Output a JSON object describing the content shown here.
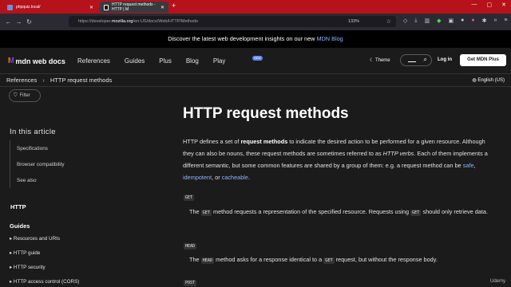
{
  "browser": {
    "tabs": [
      {
        "title": "phpquiz.local/",
        "active": false
      },
      {
        "title": "HTTP request methods - HTTP | M",
        "active": true
      }
    ],
    "url_prefix": "https://developer.",
    "url_domain": "mozilla.org",
    "url_path": "/en-US/docs/Web/HTTP/Methods",
    "zoom": "133%"
  },
  "banner": {
    "text": "Discover the latest web development insights on our new ",
    "link": "MDN Blog"
  },
  "header": {
    "logo_text": "mdn web docs",
    "nav": [
      "References",
      "Guides",
      "Plus",
      "Blog",
      "Play"
    ],
    "play_badge": "NEW",
    "theme": "Theme",
    "login": "Log in",
    "get_plus": "Get MDN Plus"
  },
  "breadcrumb": {
    "items": [
      "References",
      "HTTP request methods"
    ],
    "language": "English (US)"
  },
  "sidebar": {
    "filter": "Filter",
    "in_article": "In this article",
    "toc": [
      "Specifications",
      "Browser compatibility",
      "See also"
    ],
    "section": "HTTP",
    "guides": "Guides",
    "guide_items": [
      "Resources and URIs",
      "HTTP guide",
      "HTTP security",
      "HTTP access control (CORS)"
    ]
  },
  "main": {
    "title": "HTTP request methods",
    "intro_1": "HTTP defines a set of ",
    "intro_bold": "request methods",
    "intro_2": " to indicate the desired action to be performed for a given resource. Although they can also be nouns, these request methods are sometimes referred to as ",
    "intro_italic": "HTTP verbs",
    "intro_3": ". Each of them implements a different semantic, but some common features are shared by a group of them: e.g. a request method can be ",
    "link_safe": "safe",
    "link_idempotent": "idempotent",
    "intro_4": ", or ",
    "link_cacheable": "cacheable",
    "intro_5": ".",
    "methods": [
      {
        "term": "GET",
        "pre": "The ",
        "code": "GET",
        "mid": " method requests a representation of the specified resource. Requests using ",
        "code2": "GET",
        "post": " should only retrieve data."
      },
      {
        "term": "HEAD",
        "pre": "The ",
        "code": "HEAD",
        "mid": " method asks for a response identical to a ",
        "code2": "GET",
        "post": " request, but without the response body."
      },
      {
        "term": "POST"
      }
    ]
  },
  "watermark": "Udemy"
}
